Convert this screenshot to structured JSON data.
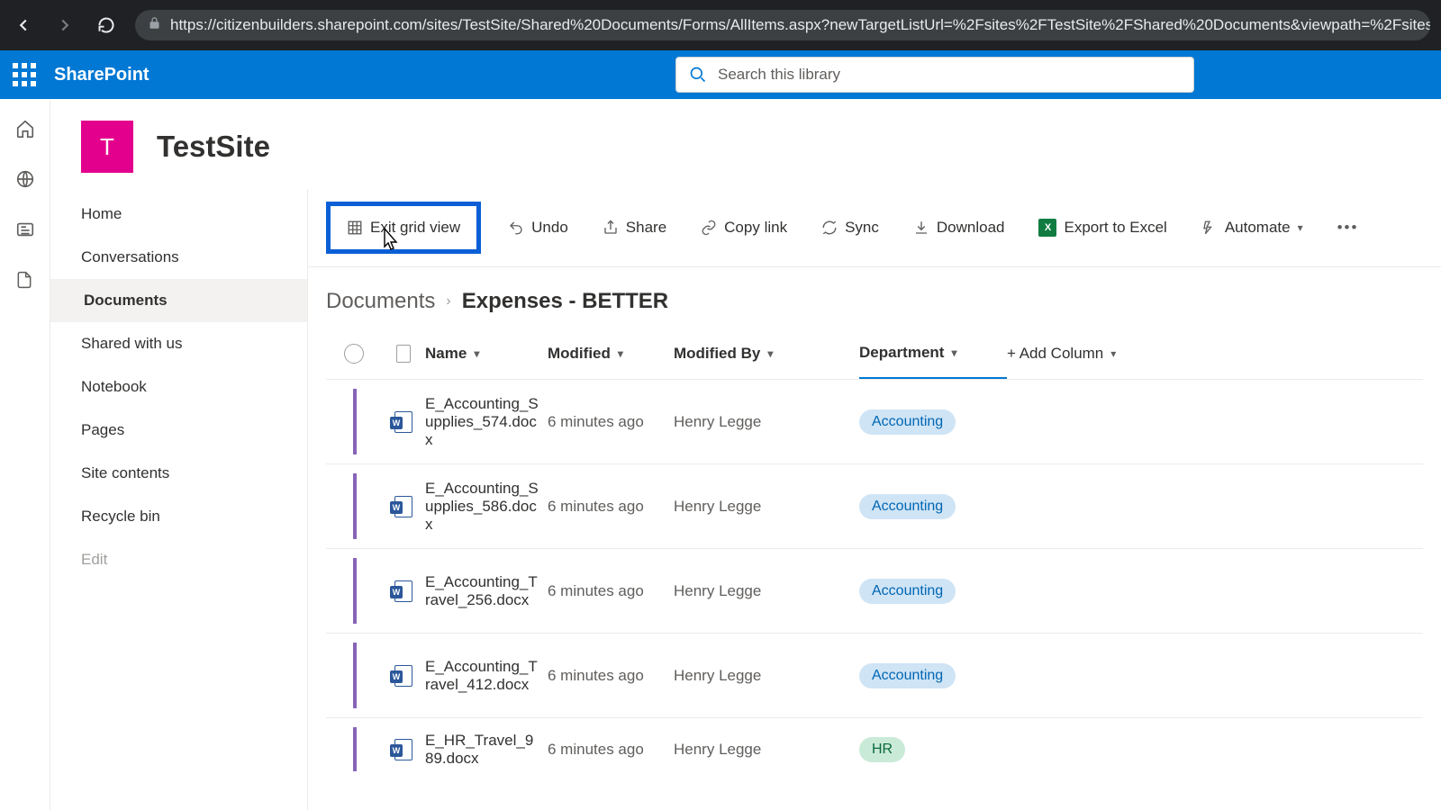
{
  "browser": {
    "url": "https://citizenbuilders.sharepoint.com/sites/TestSite/Shared%20Documents/Forms/AllItems.aspx?newTargetListUrl=%2Fsites%2FTestSite%2FShared%20Documents&viewpath=%2Fsites%"
  },
  "suite": {
    "brand": "SharePoint",
    "search_placeholder": "Search this library"
  },
  "site": {
    "logo_letter": "T",
    "title": "TestSite"
  },
  "left_nav": {
    "items": [
      "Home",
      "Conversations",
      "Documents",
      "Shared with us",
      "Notebook",
      "Pages",
      "Site contents",
      "Recycle bin"
    ],
    "edit": "Edit",
    "active_index": 2
  },
  "toolbar": {
    "exit_grid": "Exit grid view",
    "undo": "Undo",
    "share": "Share",
    "copy_link": "Copy link",
    "sync": "Sync",
    "download": "Download",
    "export": "Export to Excel",
    "automate": "Automate"
  },
  "breadcrumb": {
    "root": "Documents",
    "current": "Expenses - BETTER"
  },
  "columns": {
    "name": "Name",
    "modified": "Modified",
    "modified_by": "Modified By",
    "department": "Department",
    "add": "+ Add Column"
  },
  "rows": [
    {
      "name": "E_Accounting_Supplies_574.docx",
      "modified": "6 minutes ago",
      "modified_by": "Henry Legge",
      "department": "Accounting"
    },
    {
      "name": "E_Accounting_Supplies_586.docx",
      "modified": "6 minutes ago",
      "modified_by": "Henry Legge",
      "department": "Accounting"
    },
    {
      "name": "E_Accounting_Travel_256.docx",
      "modified": "6 minutes ago",
      "modified_by": "Henry Legge",
      "department": "Accounting"
    },
    {
      "name": "E_Accounting_Travel_412.docx",
      "modified": "6 minutes ago",
      "modified_by": "Henry Legge",
      "department": "Accounting"
    },
    {
      "name": "E_HR_Travel_989.docx",
      "modified": "6 minutes ago",
      "modified_by": "Henry Legge",
      "department": "HR"
    }
  ]
}
